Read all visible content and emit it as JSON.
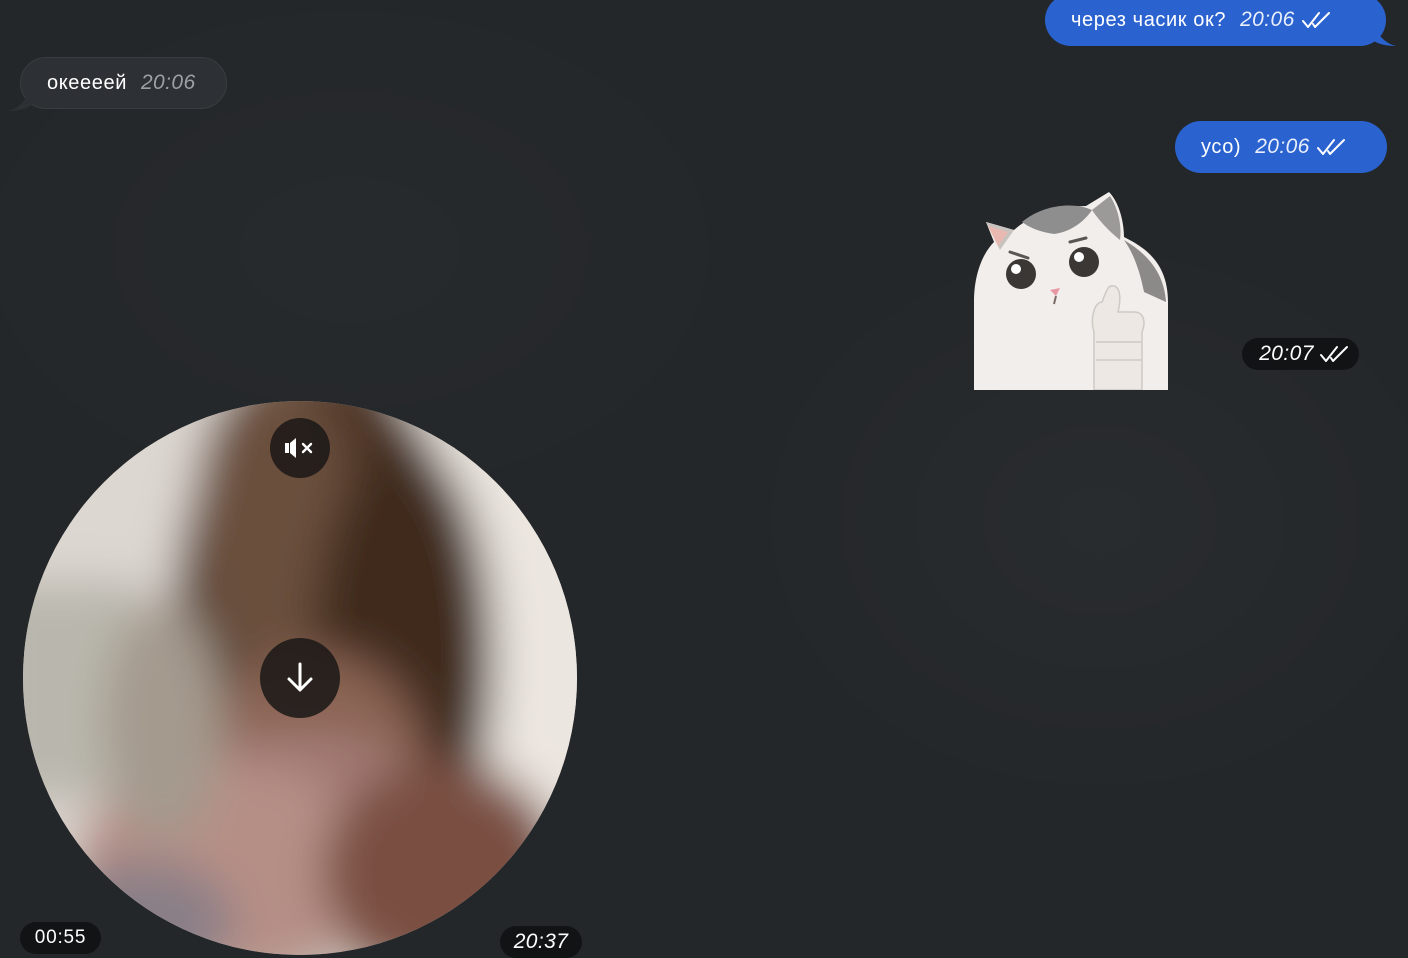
{
  "messages": [
    {
      "id": "msg1",
      "direction": "outgoing",
      "text": "через часик ок?",
      "time": "20:06",
      "status": "read"
    },
    {
      "id": "msg2",
      "direction": "incoming",
      "text": "океееей",
      "time": "20:06"
    },
    {
      "id": "msg3",
      "direction": "outgoing",
      "text": "усо)",
      "time": "20:06",
      "status": "read"
    }
  ],
  "sticker": {
    "icon": "cat-thumbs-up-sticker",
    "time": "20:07",
    "status": "read"
  },
  "video_note": {
    "duration": "00:55",
    "time": "20:37",
    "mute_icon": "speaker-muted-icon",
    "download_icon": "arrow-down-icon"
  },
  "colors": {
    "background": "#24272a",
    "outgoing_bubble": "#2a63cf",
    "incoming_bubble": "#2d3034",
    "pill": "#0e0f11"
  }
}
